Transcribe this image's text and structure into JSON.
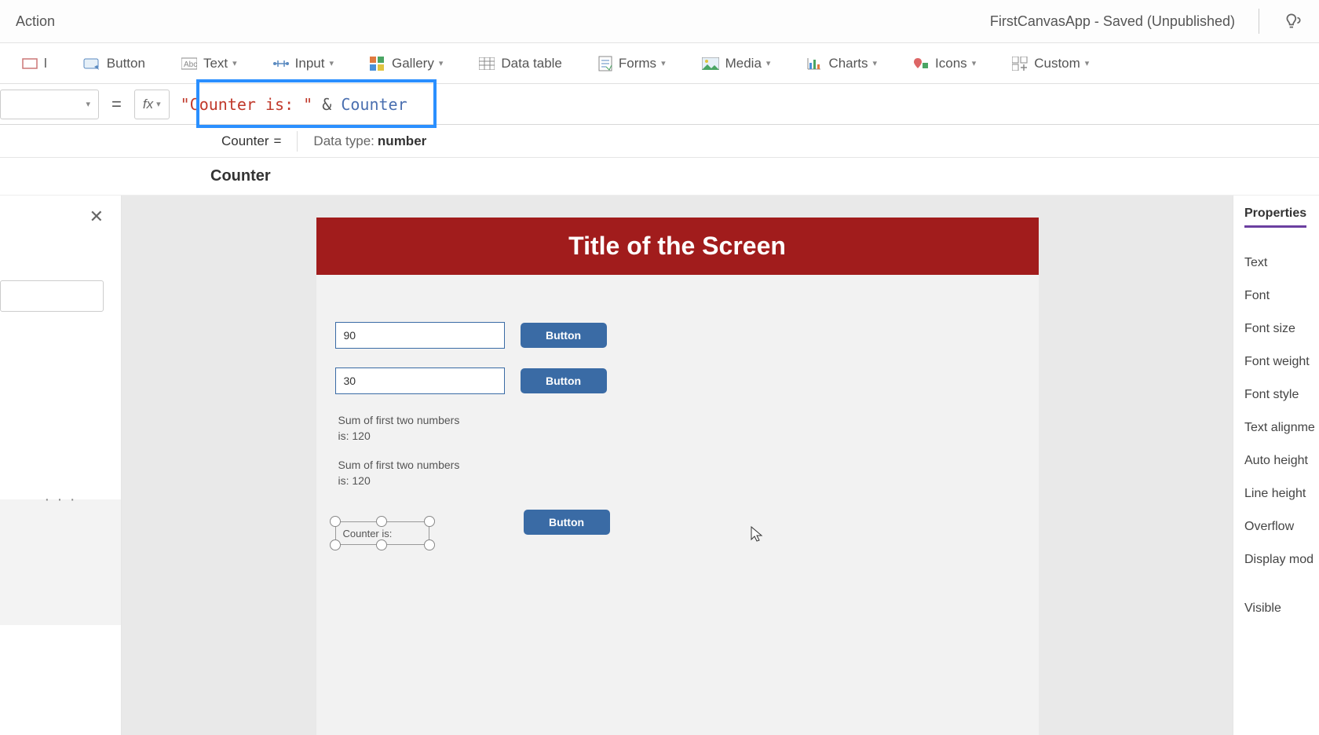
{
  "topbar": {
    "action": "Action",
    "app_status": "FirstCanvasApp - Saved (Unpublished)"
  },
  "ribbon": {
    "label_button": "Button",
    "text": "Text",
    "input": "Input",
    "gallery": "Gallery",
    "data_table": "Data table",
    "forms": "Forms",
    "media": "Media",
    "charts": "Charts",
    "icons": "Icons",
    "custom": "Custom",
    "partial_label": "l"
  },
  "formula": {
    "fx": "fx",
    "eq": "=",
    "string_part": "\"Counter is: \"",
    "op": " & ",
    "var": "Counter"
  },
  "intellisense": {
    "var_name": "Counter",
    "eq": "=",
    "dtype_label": "Data type:",
    "dtype_value": "number"
  },
  "breadcrumb": "Counter",
  "left_rail": {
    "search_placeholder": ""
  },
  "canvas": {
    "screen_title": "Title of the Screen",
    "input1": "90",
    "input2": "30",
    "button_label": "Button",
    "sum_text_1": "Sum of first two numbers is: 120",
    "sum_text_2": "Sum of first two numbers is: 120",
    "selected_label": "Counter is:"
  },
  "properties": {
    "tab": "Properties",
    "rows": [
      "Text",
      "Font",
      "Font size",
      "Font weight",
      "Font style",
      "Text alignme",
      "Auto height",
      "Line height",
      "Overflow",
      "Display mod",
      "Visible"
    ]
  }
}
